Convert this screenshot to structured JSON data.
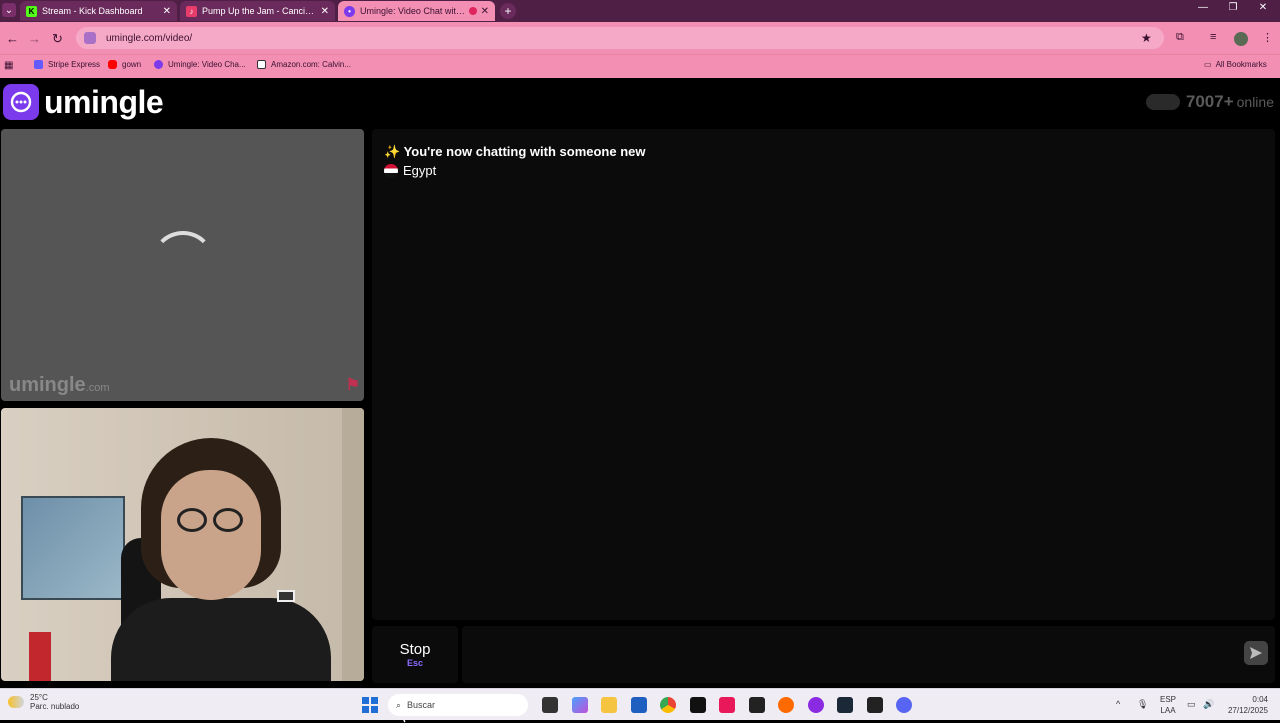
{
  "browser": {
    "tabs": [
      {
        "title": "Stream - Kick Dashboard",
        "favicon": "kick-icon",
        "color": "#53fc18"
      },
      {
        "title": "Pump Up the Jam - Canción de",
        "favicon": "music-icon",
        "color": "#e83d6b"
      },
      {
        "title": "Umingle: Video Chat with S",
        "favicon": "umingle-icon",
        "color": "#7c3aed",
        "active": true
      }
    ],
    "url": "umingle.com/video/",
    "bookmarks": [
      {
        "label": "Stripe Express",
        "icon": "stripe-icon"
      },
      {
        "label": "gown",
        "icon": "youtube-icon"
      },
      {
        "label": "Umingle: Video Cha...",
        "icon": "umingle-icon"
      },
      {
        "label": "Amazon.com: Calvin...",
        "icon": "amazon-icon"
      }
    ],
    "all_bookmarks": "All Bookmarks",
    "theme_color": "#f28fb3"
  },
  "site": {
    "logo_text": "umingle",
    "online_count": "7007+",
    "online_label": "online",
    "watermark": "umingle",
    "watermark_suffix": ".com",
    "brand_color": "#7c3aed"
  },
  "chat": {
    "system_message": "✨ You're now chatting with someone new",
    "country": "Egypt",
    "stop_label": "Stop",
    "stop_key": "Esc",
    "input_value": ""
  },
  "taskbar": {
    "weather_temp": "25°C",
    "weather_desc": "Parc. nublado",
    "search_placeholder": "Buscar",
    "lang_top": "ESP",
    "lang_bottom": "LAA",
    "time": "0:04",
    "date": "27/12/2025"
  }
}
